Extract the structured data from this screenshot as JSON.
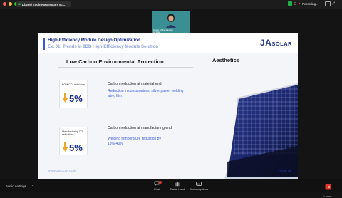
{
  "meeting": {
    "share_label": "Djamel Eddine Mansour's sc...",
    "recording_label": "Recording...",
    "video_name": "Djamel Eddine Mansour",
    "video_sub": "JA Solar"
  },
  "slide": {
    "title": "High-Efficiency Module Design Optimization",
    "subtitle": "Ex. 01: Trends in 0BB High-Efficiency Module Solution",
    "logo_main": "JA",
    "logo_sub": "SOLAR",
    "section_left": "Low Carbon Environmental Protection",
    "section_right": "Aesthetics",
    "card1_label": "BOM CO₂ reduction",
    "card1_value": "5%",
    "card2_label": "Manufacturing CO₂ reduction",
    "card2_value": "5%",
    "point1": "Carbon reduction at material end",
    "point1_detail": "Reduction in consumables: silver paste, welding wire, film",
    "point2": "Carbon reduction at manufacturing end",
    "point2_detail": "Welding temperature reduction by 15%-40%",
    "footer_url": "WWW.JASOLAR.COM",
    "page": "PAGE 16"
  },
  "toolbar": {
    "audio_label": "Audio settings",
    "chat": "Chat",
    "raise_hand": "Raise hand",
    "captions": "Show captions",
    "leave": "Leave"
  },
  "colors": {
    "accent": "#1d2f8f",
    "highlight": "#3a5bd9",
    "arrow": "#f0a52a",
    "video_bg": "#3a8f93",
    "leave": "#e0342b"
  }
}
